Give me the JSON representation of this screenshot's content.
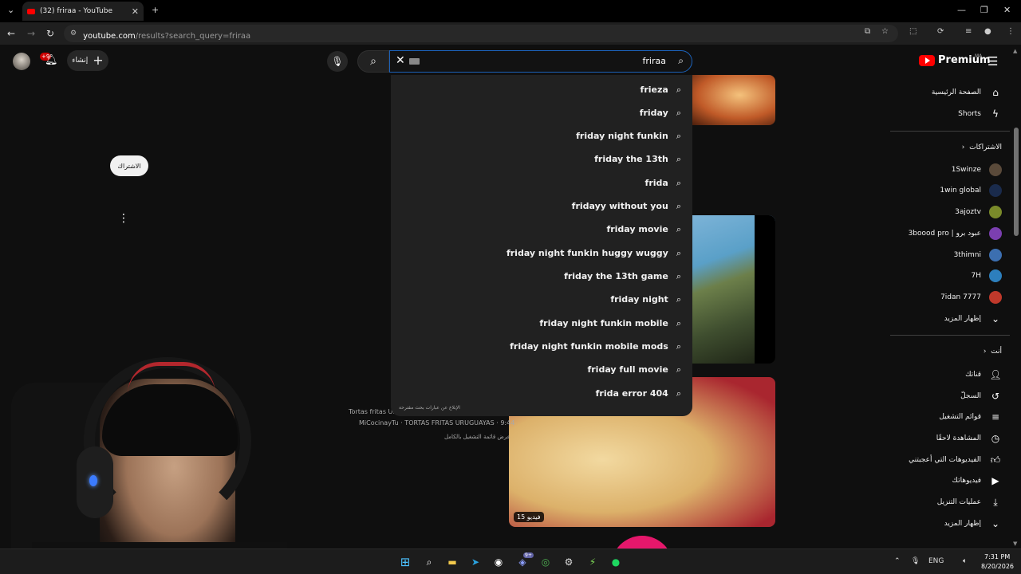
{
  "browser": {
    "tab_title": "(32) friraa - YouTube",
    "url_host": "youtube.com",
    "url_path": "/results?search_query=friraa",
    "new_tab_symbol": "+",
    "close_symbol": "✕"
  },
  "header": {
    "notif_badge": "+9",
    "create_label": "إنشاء",
    "create_symbol": "+",
    "search_value": "friraa",
    "logo_text": "Premium",
    "logo_country": "MA"
  },
  "suggestions": [
    "frieza",
    "friday",
    "friday night funkin",
    "friday the 13th",
    "frida",
    "fridayy without you",
    "friday movie",
    "friday night funkin huggy wuggy",
    "friday the 13th game",
    "friday night",
    "friday night funkin mobile",
    "friday night funkin mobile mods",
    "friday full movie",
    "frida error 404"
  ],
  "report_text": "الإبلاغ عن عبارات بحث مقترحة",
  "main": {
    "pill_label": "الاشتراك",
    "video_title_partial": "Tortas fritas Ur",
    "video_channel": "MiCocinayTu · TORTAS FRITAS URUGUAYAS · 9:44",
    "video_full_playlist": "عرض قائمة التشغيل بالكامل",
    "duration_badge": "15 فيديو"
  },
  "sidebar": {
    "home": "الصفحة الرئيسية",
    "shorts": "Shorts",
    "subscriptions_header": "الاشتراكات",
    "subscriptions": [
      {
        "name": "1Swinze",
        "color": "#5a4a3a"
      },
      {
        "name": "1win global",
        "color": "#1a2b4c"
      },
      {
        "name": "3ajoztv",
        "color": "#7a8a2a"
      },
      {
        "name": "3boood pro | عبود برو",
        "color": "#7b3fb0"
      },
      {
        "name": "3thimni",
        "color": "#3c6fb0"
      },
      {
        "name": "7H",
        "color": "#2d7fbd"
      },
      {
        "name": "7idan 7777",
        "color": "#c0392b"
      }
    ],
    "show_more_1": "إظهار المزيد",
    "you_header": "أنت",
    "you_items": [
      {
        "label": "قناتك",
        "icon": "person-icon",
        "glyph": "👤"
      },
      {
        "label": "السجلّ",
        "icon": "history-icon",
        "glyph": "↺"
      },
      {
        "label": "قوائم التشغيل",
        "icon": "playlists-icon",
        "glyph": "≡"
      },
      {
        "label": "المشاهدة لاحقًا",
        "icon": "clock-icon",
        "glyph": "◷"
      },
      {
        "label": "الفيديوهات التي أعجبتني",
        "icon": "thumbs-up-icon",
        "glyph": "👍"
      },
      {
        "label": "فيديوهاتك",
        "icon": "your-videos-icon",
        "glyph": "▶"
      },
      {
        "label": "عمليات التنزيل",
        "icon": "download-icon",
        "glyph": "⤓"
      }
    ],
    "show_more_2": "إظهار المزيد"
  },
  "taskbar": {
    "lang": "ENG",
    "time": "7:31 PM",
    "date": "8/20/2026",
    "discord_badge": "9+"
  },
  "colors": {
    "youtube_red": "#ff0000",
    "search_focus": "#1c62b9",
    "sidebar_bg": "#0f0f0f",
    "dropdown_bg": "#212121"
  }
}
